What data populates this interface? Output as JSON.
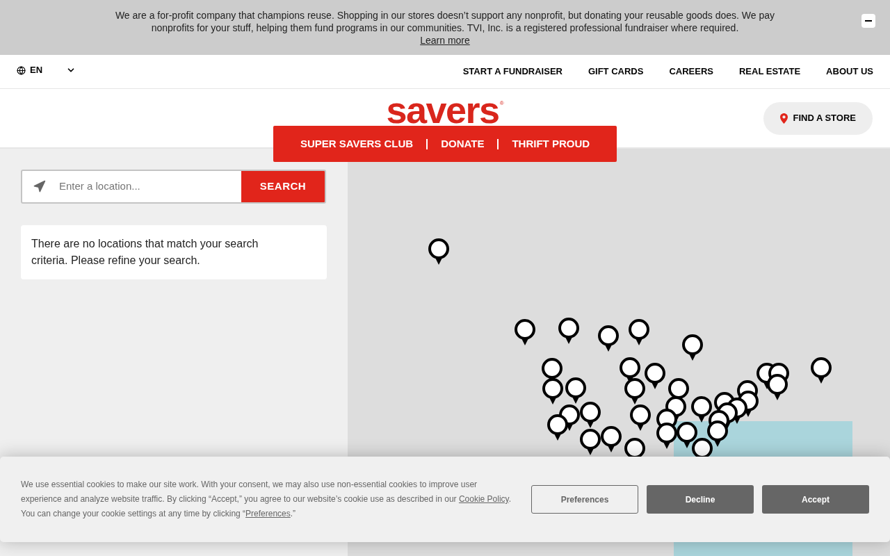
{
  "notice_bar": {
    "text": "We are a for-profit company that champions reuse. Shopping in our stores doesn’t support any nonprofit, but donating your reusable goods does. We pay nonprofits for your stuff, helping them fund programs in our communities. TVI, Inc. is a registered professional fundraiser where required.",
    "link": "Learn more"
  },
  "utility_nav": {
    "language": "EN",
    "links": [
      "START A FUNDRAISER",
      "GIFT CARDS",
      "CAREERS",
      "REAL ESTATE",
      "ABOUT US"
    ]
  },
  "header": {
    "logo": "savers",
    "logo_mark": "®",
    "find_store": "FIND A STORE"
  },
  "main_nav": [
    "SUPER SAVERS CLUB",
    "DONATE",
    "THRIFT PROUD"
  ],
  "store_search": {
    "placeholder": "Enter a location...",
    "button": "SEARCH",
    "message": "There are no locations that match your search criteria. Please refine your search."
  },
  "cookie_banner": {
    "text_before": "We use essential cookies to make our site work. With your consent, we may also use non-essential cookies to improve user experience and analyze website traffic. By clicking “Accept,” you agree to our website’s cookie use as described in our ",
    "policy_link": "Cookie Policy",
    "text_middle": ". You can change your cookie settings at any time by clicking “",
    "preferences_link": "Preferences",
    "text_after": ".”",
    "buttons": [
      {
        "label": "Preferences",
        "kind": "outline"
      },
      {
        "label": "Decline",
        "kind": "filled"
      },
      {
        "label": "Accept",
        "kind": "filled"
      }
    ]
  }
}
